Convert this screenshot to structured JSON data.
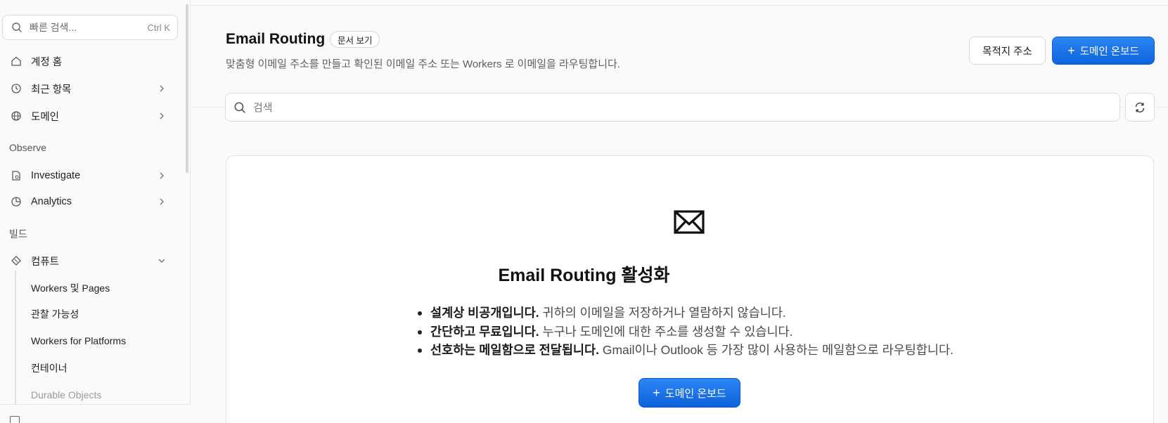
{
  "sidebar": {
    "search": {
      "placeholder": "빠른 검색...",
      "shortcut": "Ctrl K"
    },
    "items": [
      {
        "label": "계정 홈",
        "icon": "home-icon"
      },
      {
        "label": "최근 항목",
        "icon": "history-icon"
      },
      {
        "label": "도메인",
        "icon": "globe-icon"
      },
      {
        "label": "Investigate",
        "icon": "investigate-icon"
      },
      {
        "label": "Analytics",
        "icon": "pie-chart-icon"
      },
      {
        "label": "컴퓨트",
        "icon": "compute-icon"
      }
    ],
    "sections": {
      "observe": "Observe",
      "build": "빌드"
    },
    "compute_sub": [
      "Workers 및 Pages",
      "관찰 가능성",
      "Workers for Platforms",
      "컨테이너",
      "Durable Objects"
    ]
  },
  "header": {
    "title": "Email Routing",
    "doc_badge": "문서 보기",
    "subtitle": "맞춤형 이메일 주소를 만들고 확인된 이메일 주소 또는 Workers 로 이메일을 라우팅합니다.",
    "dest_button": "목적지 주소",
    "onboard_button": "도메인 온보드"
  },
  "search": {
    "placeholder": "검색"
  },
  "card": {
    "title": "Email Routing 활성화",
    "bullets": [
      {
        "bold": "설계상 비공개입니다.",
        "text": " 귀하의 이메일을 저장하거나 열람하지 않습니다."
      },
      {
        "bold": "간단하고 무료입니다.",
        "text": " 누구나 도메인에 대한 주소를 생성할 수 있습니다."
      },
      {
        "bold": "선호하는 메일함으로 전달됩니다.",
        "text": " Gmail이나 Outlook 등 가장 많이 사용하는 메일함으로 라우팅합니다."
      }
    ],
    "button": "도메인 온보드"
  },
  "colors": {
    "primary": "#1a73e8",
    "border": "#dcdcdc"
  }
}
